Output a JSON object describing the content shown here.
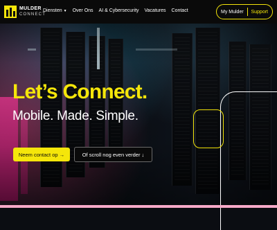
{
  "brand": {
    "name_line1": "MULDER",
    "name_line2": "CONNECT",
    "accent": "#f5e60a",
    "nav_bg": "#0a0a0a"
  },
  "nav": {
    "items": [
      {
        "label": "Diensten",
        "has_dropdown": true
      },
      {
        "label": "Over Ons"
      },
      {
        "label": "AI & Cybersecurity"
      },
      {
        "label": "Vacatures"
      },
      {
        "label": "Contact"
      }
    ],
    "my_mulder": "My Mulder",
    "support": "Support"
  },
  "hero": {
    "title": "Let’s Connect.",
    "subtitle": "Mobile. Made. Simple.",
    "cta_primary": "Neem contact op →",
    "cta_secondary": "Of scroll nog even verder ↓"
  },
  "icons": {
    "chevron": "chevron-down-icon"
  }
}
